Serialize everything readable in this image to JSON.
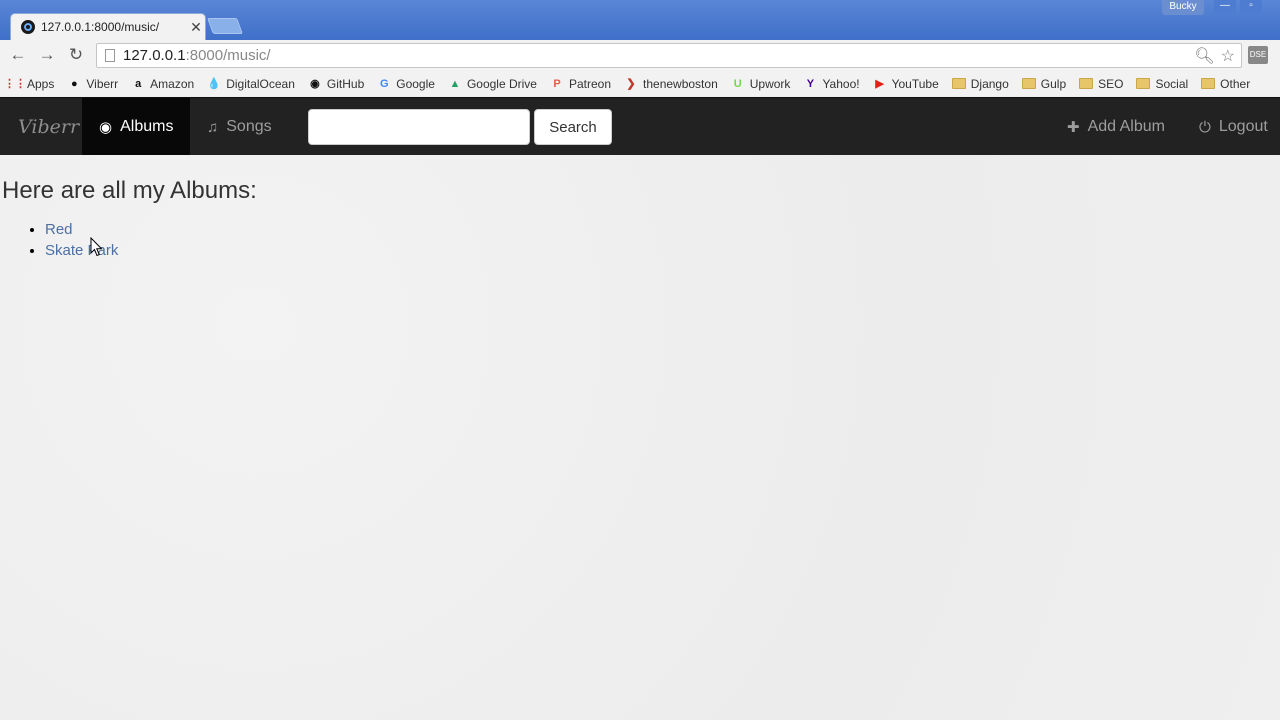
{
  "browser": {
    "tab_title": "127.0.0.1:8000/music/",
    "profile_name": "Bucky",
    "url_host": "127.0.0.1",
    "url_rest": ":8000/music/",
    "extension_label": "DSE"
  },
  "bookmarks": [
    {
      "label": "Apps",
      "icon": "apps-grid-icon",
      "glyph": "⋮⋮",
      "color": "#c0392b"
    },
    {
      "label": "Viberr",
      "icon": "viberr-icon",
      "glyph": "●",
      "color": "#111111"
    },
    {
      "label": "Amazon",
      "icon": "amazon-icon",
      "glyph": "a",
      "color": "#111111"
    },
    {
      "label": "DigitalOcean",
      "icon": "digitalocean-icon",
      "glyph": "💧",
      "color": "#2e86de"
    },
    {
      "label": "GitHub",
      "icon": "github-icon",
      "glyph": "◉",
      "color": "#111111"
    },
    {
      "label": "Google",
      "icon": "google-icon",
      "glyph": "G",
      "color": "#4285f4"
    },
    {
      "label": "Google Drive",
      "icon": "google-drive-icon",
      "glyph": "▲",
      "color": "#1fa463"
    },
    {
      "label": "Patreon",
      "icon": "patreon-icon",
      "glyph": "P",
      "color": "#e85b46"
    },
    {
      "label": "thenewboston",
      "icon": "thenewboston-icon",
      "glyph": "❯",
      "color": "#c0392b"
    },
    {
      "label": "Upwork",
      "icon": "upwork-icon",
      "glyph": "U",
      "color": "#6fda44"
    },
    {
      "label": "Yahoo!",
      "icon": "yahoo-icon",
      "glyph": "Y",
      "color": "#410093"
    },
    {
      "label": "YouTube",
      "icon": "youtube-icon",
      "glyph": "▶",
      "color": "#e62117"
    },
    {
      "label": "Django",
      "icon": "folder-icon",
      "glyph": "",
      "color": ""
    },
    {
      "label": "Gulp",
      "icon": "folder-icon",
      "glyph": "",
      "color": ""
    },
    {
      "label": "SEO",
      "icon": "folder-icon",
      "glyph": "",
      "color": ""
    },
    {
      "label": "Social",
      "icon": "folder-icon",
      "glyph": "",
      "color": ""
    },
    {
      "label": "Other",
      "icon": "folder-icon",
      "glyph": "",
      "color": ""
    }
  ],
  "navbar": {
    "brand": "Viberr",
    "albums_label": "Albums",
    "songs_label": "Songs",
    "search_button": "Search",
    "search_value": "",
    "add_album_label": "Add Album",
    "logout_label": "Logout"
  },
  "main": {
    "heading": "Here are all my Albums:",
    "albums": [
      "Red",
      "Skate Park"
    ]
  }
}
